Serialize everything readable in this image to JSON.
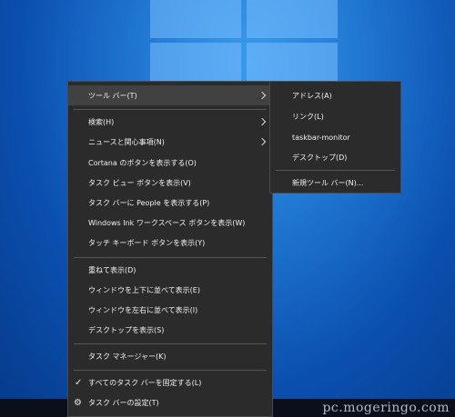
{
  "desktop": {
    "watermark": "pc.mogeringo.com"
  },
  "context_menu": {
    "toolbar": "ツール バー(T)",
    "search": "検索(H)",
    "news": "ニュースと関心事項(N)",
    "cortana": "Cortana のボタンを表示する(O)",
    "taskview": "タスク ビュー ボタンを表示(V)",
    "people": "タスク バーに People を表示する(P)",
    "ink": "Windows Ink ワークスペース ボタンを表示(W)",
    "keyboard": "タッチ キーボード ボタンを表示(Y)",
    "cascade": "重ねて表示(D)",
    "stack": "ウィンドウを上下に並べて表示(E)",
    "side_by_side": "ウィンドウを左右に並べて表示(I)",
    "show_desktop": "デスクトップを表示(S)",
    "task_manager": "タスク マネージャー(K)",
    "lock": "すべてのタスク バーを固定する(L)",
    "settings": "タスク バーの設定(T)",
    "lock_check": "✓",
    "settings_icon": "gear-icon"
  },
  "toolbar_submenu": {
    "address": "アドレス(A)",
    "links": "リンク(L)",
    "taskbar_monitor": "taskbar-monitor",
    "desktop": "デスクトップ(D)",
    "new_toolbar": "新規ツール バー(N)..."
  }
}
